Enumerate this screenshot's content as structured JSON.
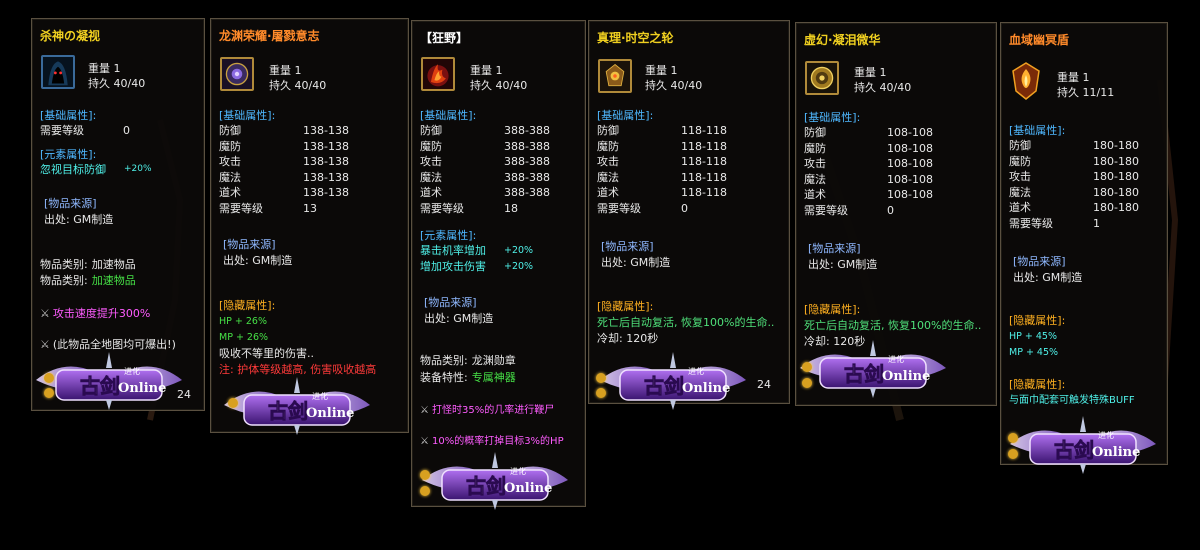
{
  "colors": {
    "gold_title": "#f0d020",
    "orange_title": "#ff8a2a",
    "section": "#4fb8ff",
    "green": "#46e046",
    "pink": "#ff5cff",
    "red": "#ff3a3a"
  },
  "cards": [
    {
      "title": "杀神の凝视",
      "icon": "hooded-demon-icon",
      "weight": "重量 1",
      "durability": "持久 40/40",
      "base_header": "[基础属性]:",
      "base_rows": [
        {
          "label": "需要等级",
          "value": "0"
        }
      ],
      "elem_header": "[元素属性]:",
      "elem_rows": [
        {
          "label": "忽视目标防御",
          "value": "+20%"
        }
      ],
      "source_header": "[物品来源]",
      "source": "出处: GM制造",
      "category_rows": [
        {
          "label": "物品类别:",
          "value": "加速物品",
          "color": "white"
        },
        {
          "label": "物品类别:",
          "value": "加速物品",
          "color": "green"
        }
      ],
      "effects": [
        "攻击速度提升300%",
        "(此物品全地图均可爆出!)"
      ],
      "partial": "24"
    },
    {
      "title": "龙渊荣耀·屠戮意志",
      "icon": "purple-rune-icon",
      "weight": "重量 1",
      "durability": "持久 40/40",
      "base_header": "[基础属性]:",
      "base_rows": [
        {
          "label": "防御",
          "value": "138-138"
        },
        {
          "label": "魔防",
          "value": "138-138"
        },
        {
          "label": "攻击",
          "value": "138-138"
        },
        {
          "label": "魔法",
          "value": "138-138"
        },
        {
          "label": "道术",
          "value": "138-138"
        },
        {
          "label": "需要等级",
          "value": "13"
        }
      ],
      "source_header": "[物品来源]",
      "source": "出处: GM制造",
      "hidden_header": "[隐藏属性]:",
      "hidden_rows": [
        "HP + 26%",
        "MP + 26%"
      ],
      "desc1": "吸收不等里的伤害..",
      "desc2": "注: 护体等级越高, 伤害吸收越高"
    },
    {
      "title": "【狂野】",
      "icon": "fire-claw-icon",
      "weight": "重量 1",
      "durability": "持久 40/40",
      "base_header": "[基础属性]:",
      "base_rows": [
        {
          "label": "防御",
          "value": "388-388"
        },
        {
          "label": "魔防",
          "value": "388-388"
        },
        {
          "label": "攻击",
          "value": "388-388"
        },
        {
          "label": "魔法",
          "value": "388-388"
        },
        {
          "label": "道术",
          "value": "388-388"
        },
        {
          "label": "需要等级",
          "value": "18"
        }
      ],
      "elem_header": "[元素属性]:",
      "elem_rows": [
        {
          "label": "暴击机率增加",
          "value": "+20%"
        },
        {
          "label": "增加攻击伤害",
          "value": "+20%"
        }
      ],
      "source_header": "[物品来源]",
      "source": "出处: GM制造",
      "category_rows": [
        {
          "label": "物品类别:",
          "value": "龙渊勋章",
          "color": "white"
        },
        {
          "label": "装备特性:",
          "value": "专属神器",
          "color": "green"
        }
      ],
      "effects": [
        "打怪时35%的几率进行鞭尸",
        "10%的概率打掉目标3%的HP"
      ]
    },
    {
      "title": "真理·时空之轮",
      "icon": "golden-amulet-icon",
      "weight": "重量 1",
      "durability": "持久 40/40",
      "base_header": "[基础属性]:",
      "base_rows": [
        {
          "label": "防御",
          "value": "118-118"
        },
        {
          "label": "魔防",
          "value": "118-118"
        },
        {
          "label": "攻击",
          "value": "118-118"
        },
        {
          "label": "魔法",
          "value": "118-118"
        },
        {
          "label": "道术",
          "value": "118-118"
        },
        {
          "label": "需要等级",
          "value": "0"
        }
      ],
      "source_header": "[物品来源]",
      "source": "出处: GM制造",
      "hidden_header": "[隐藏属性]:",
      "revive": "死亡后自动复活, 恢复100%的生命..",
      "cooldown": "冷却: 120秒",
      "partial": "24"
    },
    {
      "title": "虚幻·凝泪微华",
      "icon": "golden-gear-icon",
      "weight": "重量 1",
      "durability": "持久 40/40",
      "base_header": "[基础属性]:",
      "base_rows": [
        {
          "label": "防御",
          "value": "108-108"
        },
        {
          "label": "魔防",
          "value": "108-108"
        },
        {
          "label": "攻击",
          "value": "108-108"
        },
        {
          "label": "魔法",
          "value": "108-108"
        },
        {
          "label": "道术",
          "value": "108-108"
        },
        {
          "label": "需要等级",
          "value": "0"
        }
      ],
      "source_header": "[物品来源]",
      "source": "出处: GM制造",
      "hidden_header": "[隐藏属性]:",
      "revive": "死亡后自动复活, 恢复100%的生命..",
      "cooldown": "冷却: 120秒"
    },
    {
      "title": "血域幽冥盾",
      "icon": "flame-shield-icon",
      "weight": "重量 1",
      "durability": "持久 11/11",
      "base_header": "[基础属性]:",
      "base_rows": [
        {
          "label": "防御",
          "value": "180-180"
        },
        {
          "label": "魔防",
          "value": "180-180"
        },
        {
          "label": "攻击",
          "value": "180-180"
        },
        {
          "label": "魔法",
          "value": "180-180"
        },
        {
          "label": "道术",
          "value": "180-180"
        },
        {
          "label": "需要等级",
          "value": "1"
        }
      ],
      "source_header": "[物品来源]",
      "source": "出处: GM制造",
      "hidden_header": "[隐藏属性]:",
      "hidden_rows": [
        "HP + 45%",
        "MP + 45%"
      ],
      "hidden_header2": "[隐藏属性]:",
      "set_bonus": "与面巾配套可触发特殊BUFF"
    }
  ],
  "watermark": {
    "brand": "古剑",
    "brand_latin": "Online",
    "badge": "进化"
  }
}
